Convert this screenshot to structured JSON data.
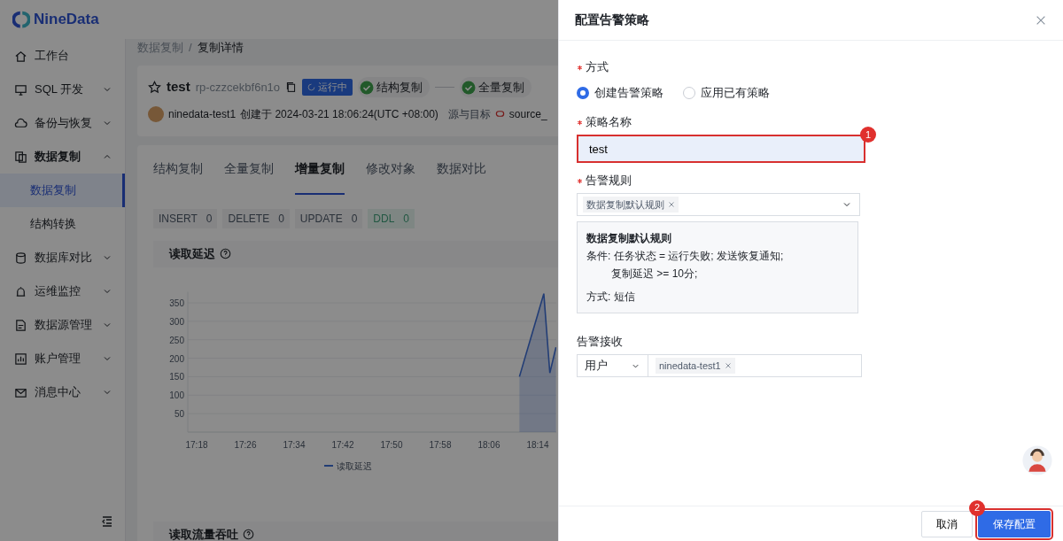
{
  "app": {
    "logo": "NineData"
  },
  "sidebar": {
    "items": [
      {
        "label": "工作台"
      },
      {
        "label": "SQL 开发",
        "expanded": false
      },
      {
        "label": "备份与恢复",
        "expanded": false
      },
      {
        "label": "数据复制",
        "expanded": true,
        "children": [
          {
            "label": "数据复制",
            "selected": true
          },
          {
            "label": "结构转换",
            "selected": false
          }
        ]
      },
      {
        "label": "数据库对比",
        "expanded": false
      },
      {
        "label": "运维监控",
        "expanded": false
      },
      {
        "label": "数据源管理",
        "expanded": false
      },
      {
        "label": "账户管理",
        "expanded": false
      },
      {
        "label": "消息中心",
        "expanded": false
      }
    ]
  },
  "breadcrumb": {
    "items": [
      "数据复制",
      "复制详情"
    ],
    "separator": "/"
  },
  "task": {
    "name": "test",
    "id": "rp-czzcekbf6n1o",
    "status": "运行中",
    "steps": [
      {
        "label": "结构复制",
        "done": true
      },
      {
        "label": "全量复制",
        "done": true
      }
    ],
    "creator": "ninedata-test1",
    "created": "创建于 2024-03-21 18:06:24(UTC +08:00)",
    "source_target_label": "源与目标",
    "source": "source_"
  },
  "tabs": [
    {
      "label": "结构复制",
      "selected": false
    },
    {
      "label": "全量复制",
      "selected": false
    },
    {
      "label": "增量复制",
      "selected": true
    },
    {
      "label": "修改对象",
      "selected": false
    },
    {
      "label": "数据对比",
      "selected": false
    }
  ],
  "counters": [
    {
      "label": "INSERT",
      "count": "0",
      "kind": "neutral"
    },
    {
      "label": "DELETE",
      "count": "0",
      "kind": "neutral"
    },
    {
      "label": "UPDATE",
      "count": "0",
      "kind": "neutral"
    },
    {
      "label": "DDL",
      "count": "0",
      "kind": "ddl"
    }
  ],
  "panels": [
    {
      "title": "读取延迟",
      "chart_data": {
        "type": "area",
        "categories": [
          "17:18",
          null,
          null,
          null,
          null,
          null,
          null,
          null,
          "17:26",
          null,
          null,
          null,
          null,
          null,
          null,
          null,
          "17:34",
          null,
          null,
          null,
          null,
          null,
          null,
          null,
          "17:42",
          null,
          null,
          null,
          null,
          null,
          null,
          null,
          "17:50",
          null,
          null,
          null,
          null,
          null,
          null,
          null,
          "17:58",
          null,
          null,
          null,
          null,
          null,
          null,
          null,
          "18:06",
          null,
          null,
          null,
          null,
          null,
          null,
          null,
          "18:14",
          null,
          null,
          null
        ],
        "series": [
          {
            "name": "读取延迟",
            "color": "#3f6fd6",
            "values": [
              null,
              null,
              null,
              null,
              null,
              null,
              null,
              null,
              null,
              null,
              null,
              null,
              null,
              null,
              null,
              null,
              null,
              null,
              null,
              null,
              null,
              null,
              null,
              null,
              null,
              null,
              null,
              null,
              null,
              null,
              null,
              null,
              null,
              null,
              null,
              null,
              null,
              null,
              null,
              null,
              null,
              null,
              null,
              null,
              null,
              null,
              null,
              null,
              null,
              null,
              null,
              null,
              null,
              150,
              206,
              262,
              318,
              375,
              160,
              230
            ]
          }
        ],
        "grid": true,
        "ylim": [
          0,
          380
        ],
        "yticks": [
          50,
          100,
          150,
          200,
          250,
          300,
          350
        ]
      }
    },
    {
      "title": "读取流量吞吐"
    }
  ],
  "drawer": {
    "title": "配置告警策略",
    "mode": {
      "label": "方式",
      "required": true,
      "options": [
        {
          "label": "创建告警策略",
          "selected": true
        },
        {
          "label": "应用已有策略",
          "selected": false
        }
      ]
    },
    "name": {
      "label": "策略名称",
      "required": true,
      "value": "test",
      "highlighted": true,
      "annotation": "1"
    },
    "rules": {
      "label": "告警规则",
      "required": true,
      "tags": [
        "数据复制默认规则"
      ],
      "detail": {
        "title": "数据复制默认规则",
        "lines": [
          {
            "text": "条件: 任务状态 = 运行失败; 发送恢复通知;",
            "indented": false
          },
          {
            "text": "复制延迟 >= 10分;",
            "indented": true
          }
        ],
        "method": "方式: 短信"
      }
    },
    "receivers": {
      "label": "告警接收",
      "required": false,
      "type": "用户",
      "tags": [
        "ninedata-test1"
      ]
    },
    "buttons": [
      {
        "label": "取消",
        "kind": "secondary",
        "highlighted": false
      },
      {
        "label": "保存配置",
        "kind": "primary",
        "highlighted": true,
        "annotation": "2"
      }
    ]
  }
}
